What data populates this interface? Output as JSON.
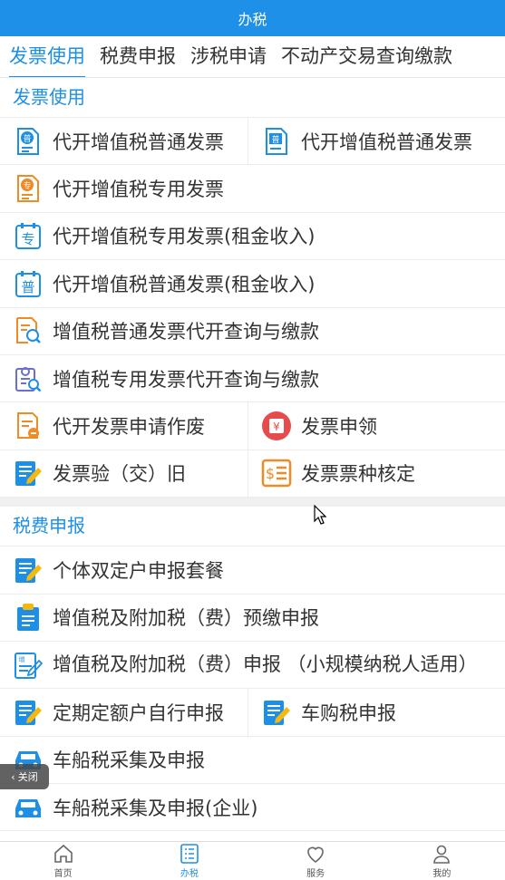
{
  "header": {
    "title": "办税"
  },
  "tabs": [
    {
      "label": "发票使用",
      "active": true
    },
    {
      "label": "税费申报"
    },
    {
      "label": "涉税申请"
    },
    {
      "label": "不动产交易查询缴款"
    }
  ],
  "sections": {
    "invoice": {
      "title": "发票使用",
      "items": {
        "i1": {
          "label": "代开增值税普通发票",
          "icon": "invoice-pu-icon"
        },
        "i2": {
          "label": "代开增值税普通发票",
          "icon": "invoice-pu-icon"
        },
        "i3": {
          "label": "代开增值税专用发票",
          "icon": "invoice-zhuan-icon"
        },
        "i4": {
          "label": "代开增值税专用发票(租金收入)",
          "icon": "calendar-zhuan-icon"
        },
        "i5": {
          "label": "代开增值税普通发票(租金收入)",
          "icon": "calendar-pu-icon"
        },
        "i6": {
          "label": "增值税普通发票代开查询与缴款",
          "icon": "document-search-icon"
        },
        "i7": {
          "label": "增值税专用发票代开查询与缴款",
          "icon": "clipboard-search-icon"
        },
        "i8": {
          "label": "代开发票申请作废",
          "icon": "document-cancel-icon"
        },
        "i9": {
          "label": "发票申领",
          "icon": "yuan-coin-icon"
        },
        "i10": {
          "label": "发票验（交）旧",
          "icon": "edit-note-icon"
        },
        "i11": {
          "label": "发票票种核定",
          "icon": "yuan-list-icon"
        }
      }
    },
    "declare": {
      "title": "税费申报",
      "items": {
        "d1": {
          "label": "个体双定户申报套餐",
          "icon": "edit-note-icon"
        },
        "d2": {
          "label": "增值税及附加税（费）预缴申报",
          "icon": "clipboard-icon"
        },
        "d3": {
          "label": "增值税及附加税（费）申报 （小规模纳税人适用）",
          "icon": "edit-outline-icon"
        },
        "d4": {
          "label": "定期定额户自行申报",
          "icon": "edit-note-icon"
        },
        "d5": {
          "label": "车购税申报",
          "icon": "edit-note-icon"
        },
        "d6": {
          "label": "车船税采集及申报",
          "icon": "car-icon"
        },
        "d7": {
          "label": "车船税采集及申报(企业)",
          "icon": "car-icon"
        }
      }
    }
  },
  "close_button": {
    "label": "关闭"
  },
  "bottom_nav": [
    {
      "label": "首页",
      "icon": "home-icon"
    },
    {
      "label": "办税",
      "icon": "list-icon",
      "active": true
    },
    {
      "label": "服务",
      "icon": "heart-icon"
    },
    {
      "label": "我的",
      "icon": "user-icon"
    }
  ],
  "colors": {
    "primary": "#1e8fe6",
    "orange": "#f08a24",
    "red": "#e74c4c"
  }
}
